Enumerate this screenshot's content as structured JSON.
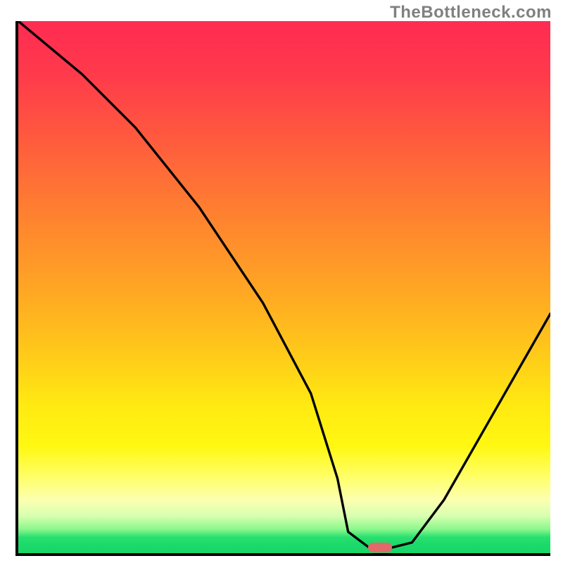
{
  "watermark": "TheBottleneck.com",
  "chart_data": {
    "type": "line",
    "title": "",
    "xlabel": "",
    "ylabel": "",
    "xlim": [
      0,
      100
    ],
    "ylim": [
      0,
      100
    ],
    "x": [
      0,
      12,
      22,
      34,
      46,
      55,
      60,
      62,
      66,
      70,
      74,
      80,
      88,
      96,
      100
    ],
    "values": [
      100,
      90,
      80,
      65,
      47,
      30,
      14,
      4,
      1,
      1,
      2,
      10,
      24,
      38,
      45
    ],
    "series_name": "bottleneck-curve",
    "marker": {
      "x": 68,
      "y": 1
    },
    "gradient_stops": [
      {
        "pos": 0,
        "color": "#ff2b52"
      },
      {
        "pos": 0.5,
        "color": "#ffa524"
      },
      {
        "pos": 0.8,
        "color": "#fff812"
      },
      {
        "pos": 1.0,
        "color": "#18d668"
      }
    ]
  }
}
